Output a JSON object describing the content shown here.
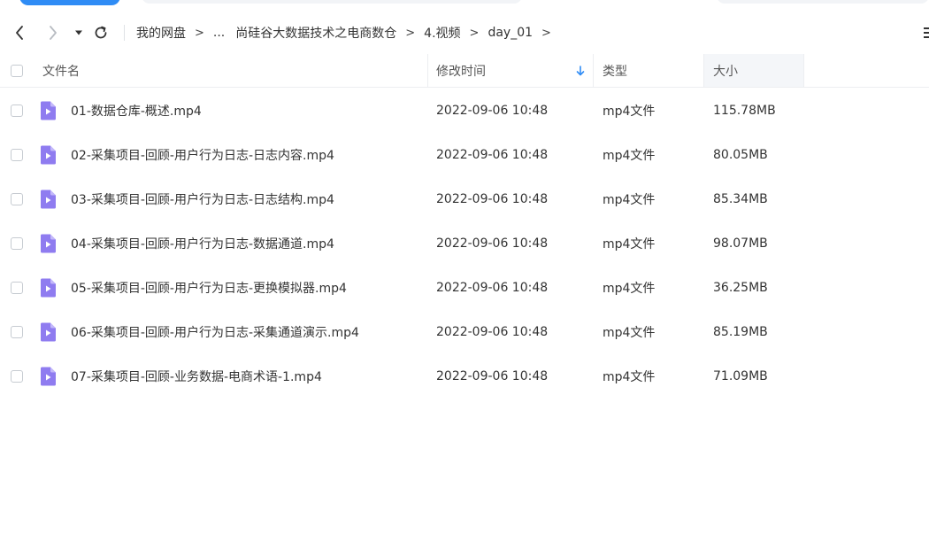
{
  "breadcrumb": {
    "items": [
      "我的网盘",
      "...",
      "尚硅谷大数据技术之电商数仓",
      "4.视频",
      "day_01"
    ],
    "separator": ">",
    "trailing_separator": ">"
  },
  "table": {
    "headers": {
      "name": "文件名",
      "modified": "修改时间",
      "type": "类型",
      "size": "大小"
    },
    "sort": {
      "column": "modified",
      "direction": "desc"
    },
    "rows": [
      {
        "name": "01-数据仓库-概述.mp4",
        "modified": "2022-09-06 10:48",
        "type": "mp4文件",
        "size": "115.78MB"
      },
      {
        "name": "02-采集项目-回顾-用户行为日志-日志内容.mp4",
        "modified": "2022-09-06 10:48",
        "type": "mp4文件",
        "size": "80.05MB"
      },
      {
        "name": "03-采集项目-回顾-用户行为日志-日志结构.mp4",
        "modified": "2022-09-06 10:48",
        "type": "mp4文件",
        "size": "85.34MB"
      },
      {
        "name": "04-采集项目-回顾-用户行为日志-数据通道.mp4",
        "modified": "2022-09-06 10:48",
        "type": "mp4文件",
        "size": "98.07MB"
      },
      {
        "name": "05-采集项目-回顾-用户行为日志-更换模拟器.mp4",
        "modified": "2022-09-06 10:48",
        "type": "mp4文件",
        "size": "36.25MB"
      },
      {
        "name": "06-采集项目-回顾-用户行为日志-采集通道演示.mp4",
        "modified": "2022-09-06 10:48",
        "type": "mp4文件",
        "size": "85.19MB"
      },
      {
        "name": "07-采集项目-回顾-业务数据-电商术语-1.mp4",
        "modified": "2022-09-06 10:48",
        "type": "mp4文件",
        "size": "71.09MB"
      }
    ]
  },
  "icons": {
    "file": "video-file-icon",
    "sort": "sort-arrow-down-icon"
  },
  "colors": {
    "accent": "#2f8cf5",
    "video_icon": "#8f7cf0",
    "video_icon_fold": "#c3b8fa"
  }
}
